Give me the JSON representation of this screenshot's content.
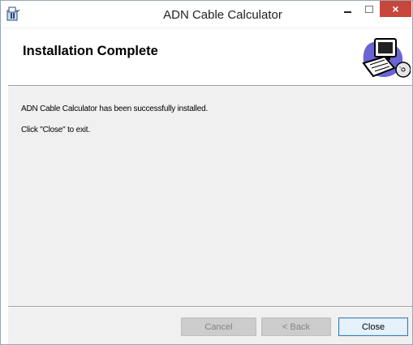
{
  "window": {
    "title": "ADN Cable Calculator",
    "close_glyph": "×"
  },
  "banner": {
    "title": "Installation Complete",
    "art_icon": "computer-cd-icon"
  },
  "content": {
    "message1": "ADN Cable Calculator has been successfully installed.",
    "message2": "Click \"Close\" to exit."
  },
  "buttons": {
    "cancel": "Cancel",
    "back": "< Back",
    "close": "Close"
  },
  "colors": {
    "close_button": "#c7473c",
    "default_button_border": "#3c7fb1"
  }
}
